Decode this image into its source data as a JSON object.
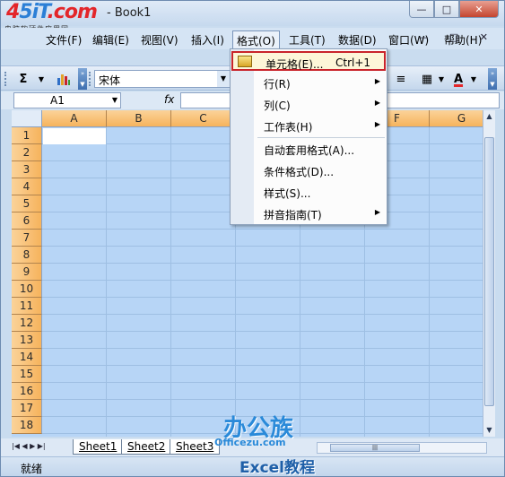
{
  "window": {
    "title": "- Book1",
    "logo_main_a": "4",
    "logo_main_b": "5iT",
    "logo_main_c": ".com",
    "logo_sub": "电脑软硬件应用网",
    "min": "—",
    "max": "□",
    "close": "✕"
  },
  "menubar": {
    "items": [
      {
        "label": "文件(F)"
      },
      {
        "label": "编辑(E)"
      },
      {
        "label": "视图(V)"
      },
      {
        "label": "插入(I)"
      },
      {
        "label": "格式(O)"
      },
      {
        "label": "工具(T)"
      },
      {
        "label": "数据(D)"
      },
      {
        "label": "窗口(W)"
      },
      {
        "label": "帮助(H)"
      }
    ],
    "mdi": "— □ ✕"
  },
  "toolbar": {
    "sum_icon": "Σ",
    "chart_icon": "chart-icon",
    "font_name": "宋体",
    "align_right_icon": "≡",
    "border_icon": "▦",
    "font_color_icon": "A",
    "font_color": "#e3262a"
  },
  "formula": {
    "cell_ref": "A1",
    "fx": "fx",
    "value": ""
  },
  "grid": {
    "columns": [
      "A",
      "B",
      "C",
      "D",
      "E",
      "F",
      "G"
    ],
    "rows": [
      "1",
      "2",
      "3",
      "4",
      "5",
      "6",
      "7",
      "8",
      "9",
      "10",
      "11",
      "12",
      "13",
      "14",
      "15",
      "16",
      "17",
      "18"
    ],
    "selection_color": "#b7d5f6",
    "header_color": "#f6b35c"
  },
  "format_menu": {
    "items": [
      {
        "label": "单元格(E)...",
        "shortcut": "Ctrl+1",
        "has_submenu": false,
        "highlighted": true
      },
      {
        "label": "行(R)",
        "shortcut": "",
        "has_submenu": true
      },
      {
        "label": "列(C)",
        "shortcut": "",
        "has_submenu": true
      },
      {
        "label": "工作表(H)",
        "shortcut": "",
        "has_submenu": true
      },
      {
        "label": "自动套用格式(A)...",
        "shortcut": "",
        "has_submenu": false
      },
      {
        "label": "条件格式(D)...",
        "shortcut": "",
        "has_submenu": false
      },
      {
        "label": "样式(S)...",
        "shortcut": "",
        "has_submenu": false
      },
      {
        "label": "拼音指南(T)",
        "shortcut": "",
        "has_submenu": true
      }
    ]
  },
  "sheets": {
    "tabs": [
      "Sheet1",
      "Sheet2",
      "Sheet3"
    ],
    "nav": "|◀ ◀ ▶ ▶|"
  },
  "status": {
    "text": "就绪"
  },
  "watermark": {
    "top": "办公族",
    "mid": "Officezu.com",
    "bottom": "Excel教程"
  }
}
